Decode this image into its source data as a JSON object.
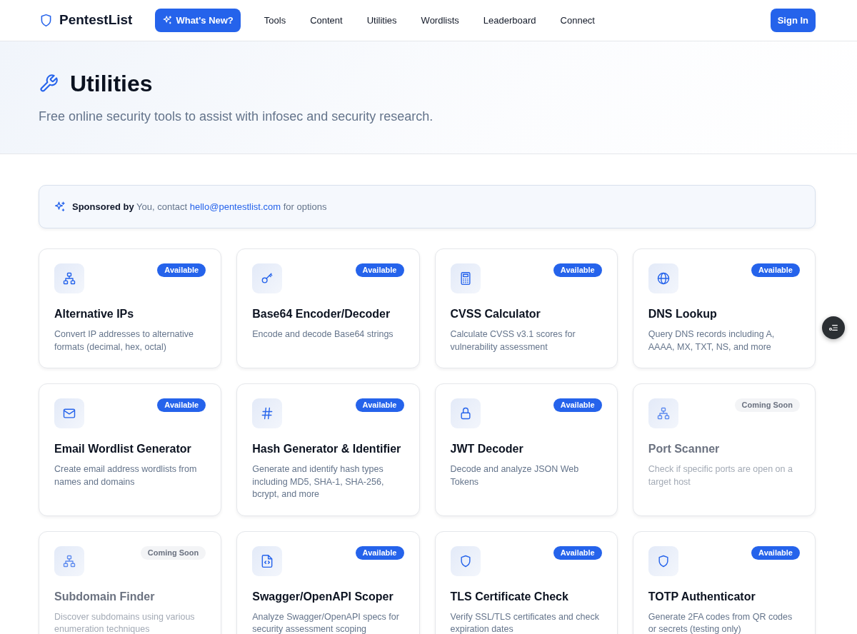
{
  "brand": {
    "name": "PentestList"
  },
  "whats_new": {
    "label": "What's New?"
  },
  "nav": [
    {
      "label": "Tools"
    },
    {
      "label": "Content"
    },
    {
      "label": "Utilities"
    },
    {
      "label": "Wordlists"
    },
    {
      "label": "Leaderboard"
    },
    {
      "label": "Connect"
    }
  ],
  "sign_in": {
    "label": "Sign In"
  },
  "header": {
    "title": "Utilities",
    "subtitle": "Free online security tools to assist with infosec and security research."
  },
  "sponsor": {
    "text_before": "**Sponsored by** You, contact",
    "email": "hello@pentestlist.com",
    "text_after": "for options"
  },
  "tools": [
    {
      "title": "Alternative IPs",
      "description": "Convert IP addresses to alternative formats (decimal, hex, octal)",
      "status": "Available",
      "available": true
    },
    {
      "title": "Base64 Encoder/Decoder",
      "description": "Encode and decode Base64 strings",
      "status": "Available",
      "available": true
    },
    {
      "title": "CVSS Calculator",
      "description": "Calculate CVSS v3.1 scores for vulnerability assessment",
      "status": "Available",
      "available": true
    },
    {
      "title": "DNS Lookup",
      "description": "Query DNS records including A, AAAA, MX, TXT, NS, and more",
      "status": "Available",
      "available": true
    },
    {
      "title": "Email Wordlist Generator",
      "description": "Create email address wordlists from names and domains",
      "status": "Available",
      "available": true
    },
    {
      "title": "Hash Generator & Identifier",
      "description": "Generate and identify hash types including MD5, SHA-1, SHA-256, bcrypt, and more",
      "status": "Available",
      "available": true
    },
    {
      "title": "JWT Decoder",
      "description": "Decode and analyze JSON Web Tokens",
      "status": "Available",
      "available": true
    },
    {
      "title": "Port Scanner",
      "description": "Check if specific ports are open on a target host",
      "status": "Coming Soon",
      "available": false
    },
    {
      "title": "Subdomain Finder",
      "description": "Discover subdomains using various enumeration techniques",
      "status": "Coming Soon",
      "available": false
    },
    {
      "title": "Swagger/OpenAPI Scoper",
      "description": "Analyze Swagger/OpenAPI specs for security assessment scoping",
      "status": "Available",
      "available": true
    },
    {
      "title": "TLS Certificate Check",
      "description": "Verify SSL/TLS certificates and check expiration dates",
      "status": "Available",
      "available": true
    },
    {
      "title": "TOTP Authenticator",
      "description": "Generate 2FA codes from QR codes or secrets (testing only)",
      "status": "Available",
      "available": true
    }
  ]
}
